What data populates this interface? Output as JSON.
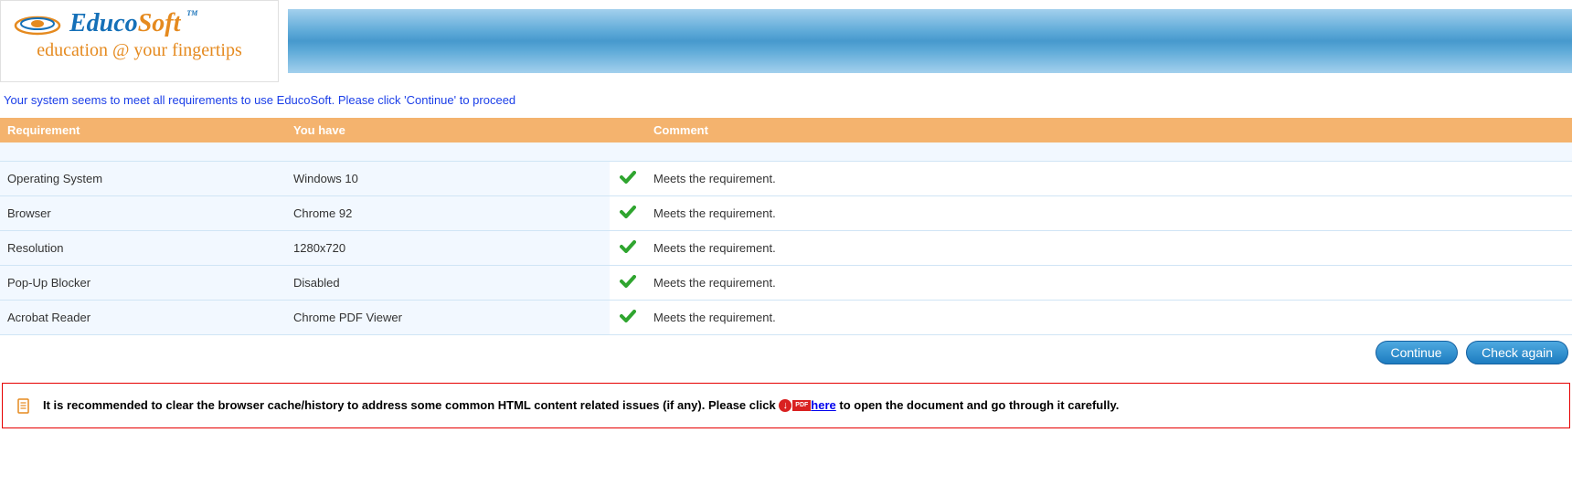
{
  "logo": {
    "educo": "Educo",
    "soft": "Soft",
    "tm": "TM",
    "tagline": "education @ your fingertips"
  },
  "status_message": "Your system seems to meet all requirements to use EducoSoft. Please click 'Continue' to proceed",
  "table": {
    "headers": {
      "requirement": "Requirement",
      "youhave": "You have",
      "comment": "Comment"
    },
    "rows": [
      {
        "requirement": "Operating System",
        "youhave": "Windows 10",
        "comment": "Meets the requirement.",
        "pass": true
      },
      {
        "requirement": "Browser",
        "youhave": "Chrome 92",
        "comment": "Meets the requirement.",
        "pass": true
      },
      {
        "requirement": "Resolution",
        "youhave": "1280x720",
        "comment": "Meets the requirement.",
        "pass": true
      },
      {
        "requirement": "Pop-Up Blocker",
        "youhave": "Disabled",
        "comment": "Meets the requirement.",
        "pass": true
      },
      {
        "requirement": "Acrobat Reader",
        "youhave": "Chrome PDF Viewer",
        "comment": "Meets the requirement.",
        "pass": true
      }
    ]
  },
  "buttons": {
    "continue": "Continue",
    "check_again": "Check again"
  },
  "notice": {
    "text_before": "It is recommended to clear the browser cache/history to address some common HTML content related issues (if any). Please click ",
    "pdf_label": "PDF",
    "here": "here",
    "text_after": " to open the document and go through it carefully."
  }
}
